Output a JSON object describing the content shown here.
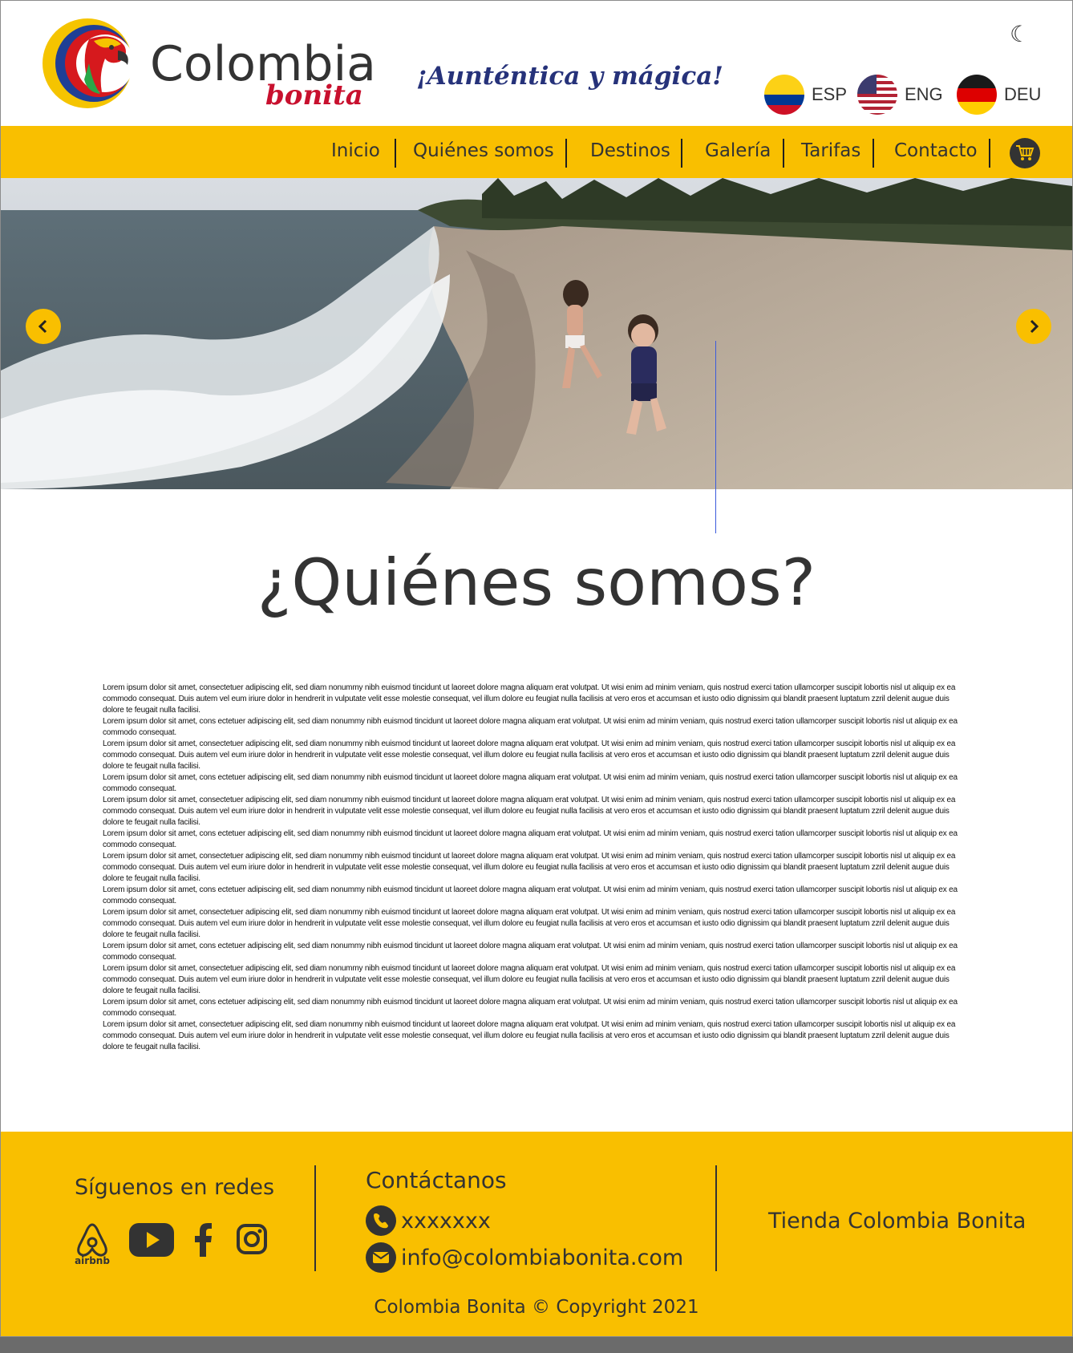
{
  "header": {
    "brand_name": "Colombia",
    "brand_sub": "bonita",
    "tagline": "¡Aunténtica y mágica!",
    "theme_icon": "moon-icon",
    "languages": [
      {
        "code": "ESP",
        "flag": "colombia-flag-icon"
      },
      {
        "code": "ENG",
        "flag": "usa-flag-icon"
      },
      {
        "code": "DEU",
        "flag": "germany-flag-icon"
      }
    ]
  },
  "nav": {
    "items": [
      "Inicio",
      "Quiénes somos",
      "Destinos",
      "Galería",
      "Tarifas",
      "Contacto"
    ],
    "cart_icon": "shopping-cart-icon"
  },
  "hero": {
    "image": "beach-with-children-photo",
    "prev_icon": "chevron-left-icon",
    "next_icon": "chevron-right-icon"
  },
  "main": {
    "title": "¿Quiénes somos?",
    "paragraph_long": "Lorem ipsum dolor sit amet, consectetuer adipiscing elit, sed diam nonummy nibh euismod tincidunt ut laoreet dolore magna aliquam erat volutpat. Ut wisi enim ad minim veniam, quis nostrud exerci tation ullamcorper suscipit lobortis nisl ut aliquip ex ea commodo consequat. Duis autem vel eum iriure dolor in hendrerit in vulputate velit esse molestie consequat, vel illum dolore eu feugiat nulla facilisis at vero eros et accumsan et iusto odio dignissim qui blandit praesent luptatum zzril delenit augue duis dolore te feugait nulla facilisi.",
    "paragraph_short": "Lorem ipsum dolor sit amet, cons ectetuer adipiscing elit, sed diam nonummy nibh euismod tincidunt ut laoreet dolore magna aliquam erat volutpat. Ut wisi enim ad minim veniam, quis nostrud exerci tation ullamcorper suscipit lobortis nisl ut aliquip ex ea commodo consequat."
  },
  "footer": {
    "follow_heading": "Síguenos en redes",
    "social": [
      "airbnb-icon",
      "youtube-icon",
      "facebook-icon",
      "instagram-icon"
    ],
    "airbnb_label": "airbnb",
    "contact_heading": "Contáctanos",
    "phone": "xxxxxxx",
    "email": "info@colombiabonita.com",
    "store": "Tienda Colombia Bonita",
    "copyright": "Colombia Bonita © Copyright 2021"
  },
  "colors": {
    "accent": "#f9bf00",
    "dark": "#333333",
    "brand_red": "#c8102e",
    "tagline_blue": "#26327a"
  }
}
